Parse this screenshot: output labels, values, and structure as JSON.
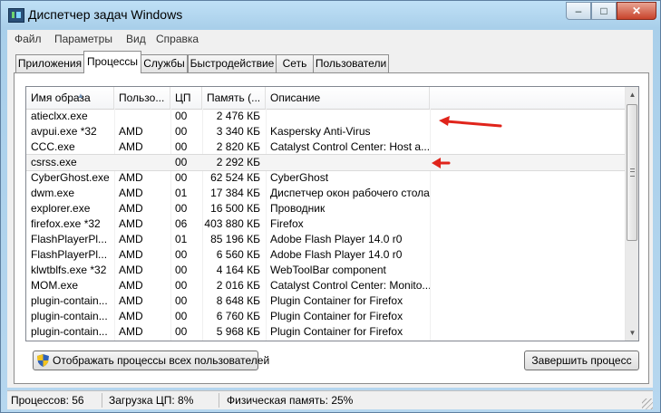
{
  "window": {
    "title": "Диспетчер задач Windows",
    "min": "–",
    "max": "□",
    "close": "✕"
  },
  "menu": [
    "Файл",
    "Параметры",
    "Вид",
    "Справка"
  ],
  "tabs": [
    "Приложения",
    "Процессы",
    "Службы",
    "Быстродействие",
    "Сеть",
    "Пользователи"
  ],
  "active_tab": "Процессы",
  "table": {
    "columns": [
      "Имя образа",
      "Пользо...",
      "ЦП",
      "Память (...",
      "Описание"
    ],
    "rows": [
      [
        "atieclxx.exe",
        "",
        "00",
        "2 476 КБ",
        ""
      ],
      [
        "avpui.exe *32",
        "AMD",
        "00",
        "3 340 КБ",
        "Kaspersky Anti-Virus"
      ],
      [
        "CCC.exe",
        "AMD",
        "00",
        "2 820 КБ",
        "Catalyst Control Center: Host a..."
      ],
      [
        "csrss.exe",
        "",
        "00",
        "2 292 КБ",
        ""
      ],
      [
        "CyberGhost.exe",
        "AMD",
        "00",
        "62 524 КБ",
        "CyberGhost"
      ],
      [
        "dwm.exe",
        "AMD",
        "01",
        "17 384 КБ",
        "Диспетчер окон рабочего стола"
      ],
      [
        "explorer.exe",
        "AMD",
        "00",
        "16 500 КБ",
        "Проводник"
      ],
      [
        "firefox.exe *32",
        "AMD",
        "06",
        "403 880 КБ",
        "Firefox"
      ],
      [
        "FlashPlayerPl...",
        "AMD",
        "01",
        "85 196 КБ",
        "Adobe Flash Player 14.0 r0"
      ],
      [
        "FlashPlayerPl...",
        "AMD",
        "00",
        "6 560 КБ",
        "Adobe Flash Player 14.0 r0"
      ],
      [
        "klwtblfs.exe *32",
        "AMD",
        "00",
        "4 164 КБ",
        "WebToolBar component"
      ],
      [
        "MOM.exe",
        "AMD",
        "00",
        "2 016 КБ",
        "Catalyst Control Center: Monito..."
      ],
      [
        "plugin-contain...",
        "AMD",
        "00",
        "8 648 КБ",
        "Plugin Container for Firefox"
      ],
      [
        "plugin-contain...",
        "AMD",
        "00",
        "6 760 КБ",
        "Plugin Container for Firefox"
      ],
      [
        "plugin-contain...",
        "AMD",
        "00",
        "5 968 КБ",
        "Plugin Container for Firefox"
      ]
    ]
  },
  "buttons": {
    "show_all": "Отображать процессы всех пользователей",
    "end_process": "Завершить процесс"
  },
  "status": {
    "processes": "Процессов: 56",
    "cpu": "Загрузка ЦП: 8%",
    "memory": "Физическая память: 25%"
  },
  "colors": {
    "annotation_arrow": "#e0241b",
    "close_button": "#c8432b",
    "title_bar": "#bfe0f6"
  }
}
